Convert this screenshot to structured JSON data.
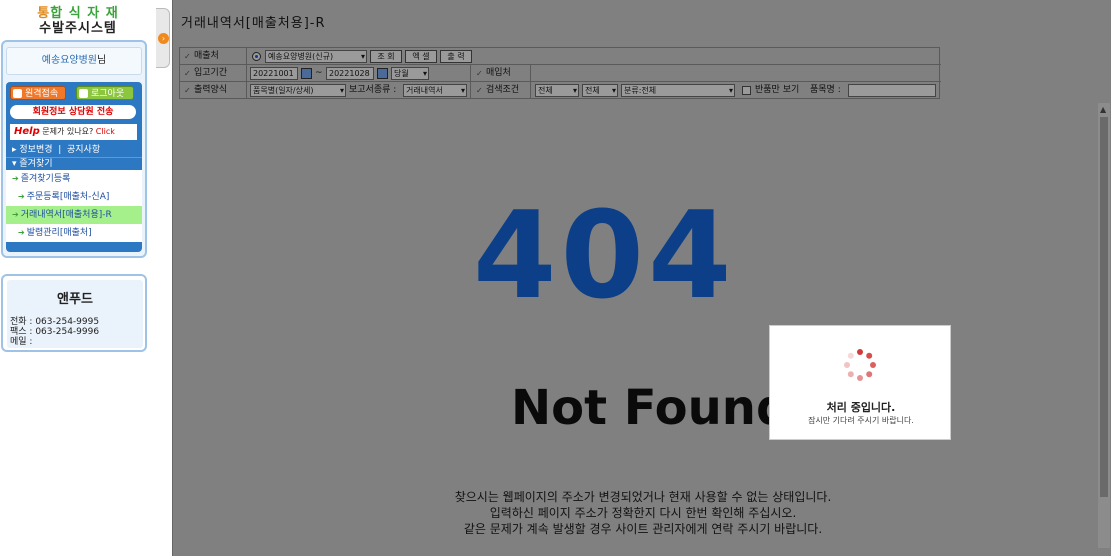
{
  "logo": {
    "line1_a": "통",
    "line1_b": "합",
    "line1_c": " 식 자 재",
    "line2": "수발주시스템"
  },
  "user": {
    "name": "예송요양병원",
    "suffix": "님"
  },
  "sidebar": {
    "remote_label": "원격접속",
    "logout_label": "로그아웃",
    "member_label": "회원정보 상담원 전송",
    "help_brand": "Help",
    "help_text": "문제가 있나요?",
    "help_click": "Click",
    "info_label": "정보변경",
    "notice_label": "공지사항",
    "favorites_header": "즐겨찾기",
    "favorites": [
      {
        "label": "즐겨찾기등록"
      },
      {
        "label": "주문등록[매출처-신A]"
      },
      {
        "label": "거래내역서[매출처용]-R"
      },
      {
        "label": "발령관리[매출처]"
      }
    ]
  },
  "contact": {
    "company": "앤푸드",
    "phone_label": "전화 : ",
    "phone": "063-254-9995",
    "fax_label": "팩스 : ",
    "fax": "063-254-9996",
    "email_label": "메일 :"
  },
  "page": {
    "title": "거래내역서[매출처용]-R"
  },
  "filters": {
    "customer_label": "매출처",
    "customer_value": "예송요양병원(신규)",
    "search_button": "조 회",
    "excel_button": "엑 셀",
    "print_button": "출 력",
    "period_label": "입고기간",
    "date_from": "20221001",
    "tilde": "~",
    "date_to": "20221028",
    "month_select": "당월",
    "purchase_label": "매입처",
    "output_label": "출력양식",
    "output_value": "품목별(일자/상세)",
    "report_label": "보고서종류 :",
    "report_value": "거래내역서",
    "condition_label": "검색조건",
    "cond1": "전체",
    "cond2": "전체",
    "category": "분류:전체",
    "returns_label": "반품만 보기",
    "itemname_label": "품목명 :"
  },
  "error": {
    "code": "404",
    "title": "Not Found",
    "msg1": "찾으시는 웹페이지의 주소가 변경되었거나 현재 사용할 수 없는 상태입니다.",
    "msg2": "입력하신 페이지 주소가 정확한지 다시 한번 확인해 주십시오.",
    "msg3": "같은 문제가 계속 발생할 경우 사이트 관리자에게 연락 주시기 바랍니다."
  },
  "loading": {
    "title": "처리 중입니다.",
    "subtitle": "잠시만 기다려 주시기 바랍니다."
  },
  "colors": {
    "accent": "#0c3f88",
    "sidebar_blue": "#2d78c2",
    "active_fav": "#a6f08c",
    "spinner": "#d23a3a"
  }
}
